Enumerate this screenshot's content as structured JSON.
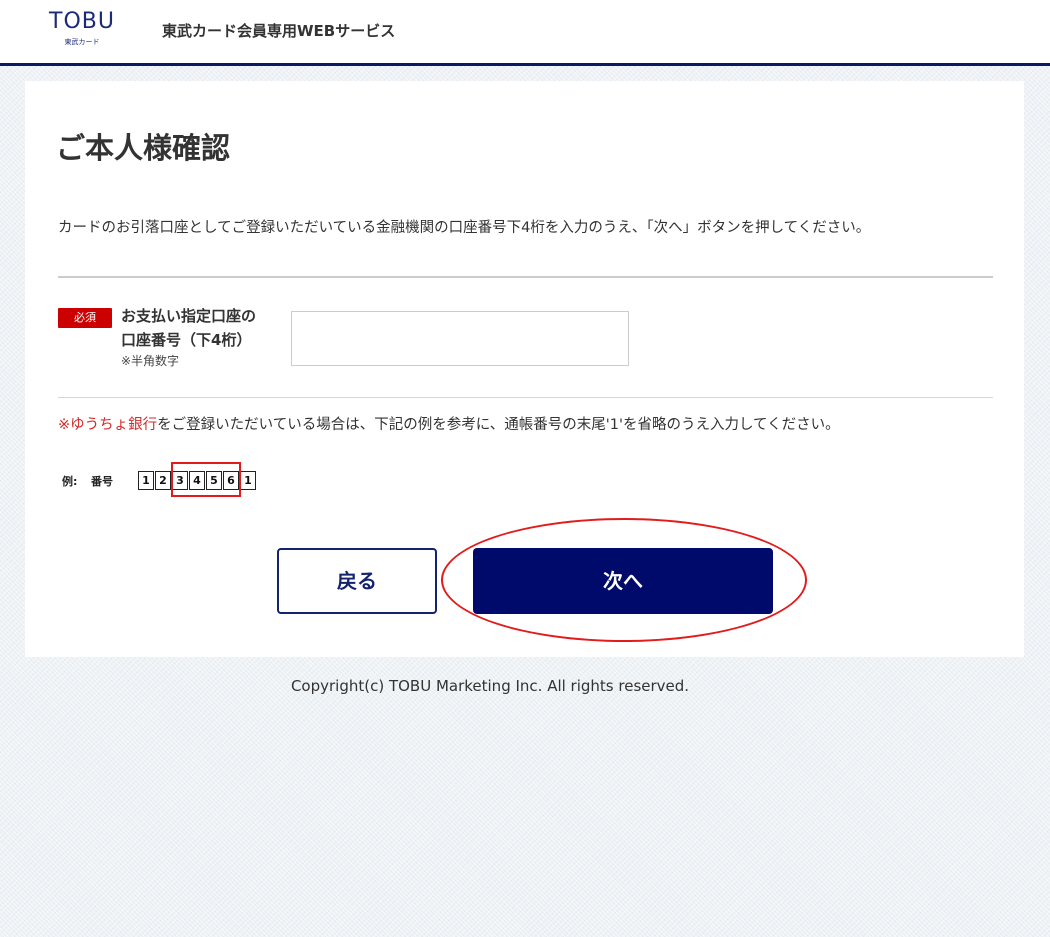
{
  "header": {
    "logo_word": "TOBU",
    "logo_sub": "東武カード",
    "site_title": "東武カード会員専用WEBサービス"
  },
  "main": {
    "page_title": "ご本人様確認",
    "instruction": "カードのお引落口座としてご登録いただいている金融機関の口座番号下4桁を入力のうえ、「次へ」ボタンを押してください。",
    "field": {
      "required_badge": "必須",
      "label_line1": "お支払い指定口座の",
      "label_line2": "口座番号（下4桁）",
      "note": "※半角数字",
      "value": "",
      "placeholder": ""
    },
    "yucho_note": {
      "highlight": "※ゆうちょ銀行",
      "rest": "をご登録いただいている場合は、下記の例を参考に、通帳番号の末尾'1'を省略のうえ入力してください。"
    },
    "example": {
      "label": "例:",
      "number_label": "番号",
      "digits": [
        "1",
        "2",
        "3",
        "4",
        "5",
        "6",
        "1"
      ]
    },
    "buttons": {
      "back_label": "戻る",
      "next_label": "次へ"
    }
  },
  "footer": {
    "copyright": "Copyright(c) TOBU Marketing Inc. All rights reserved."
  },
  "colors": {
    "brand_navy": "#0c1a63",
    "next_button": "#000a6b",
    "required_red": "#cc0000",
    "annotation_red": "#e21c1c"
  }
}
